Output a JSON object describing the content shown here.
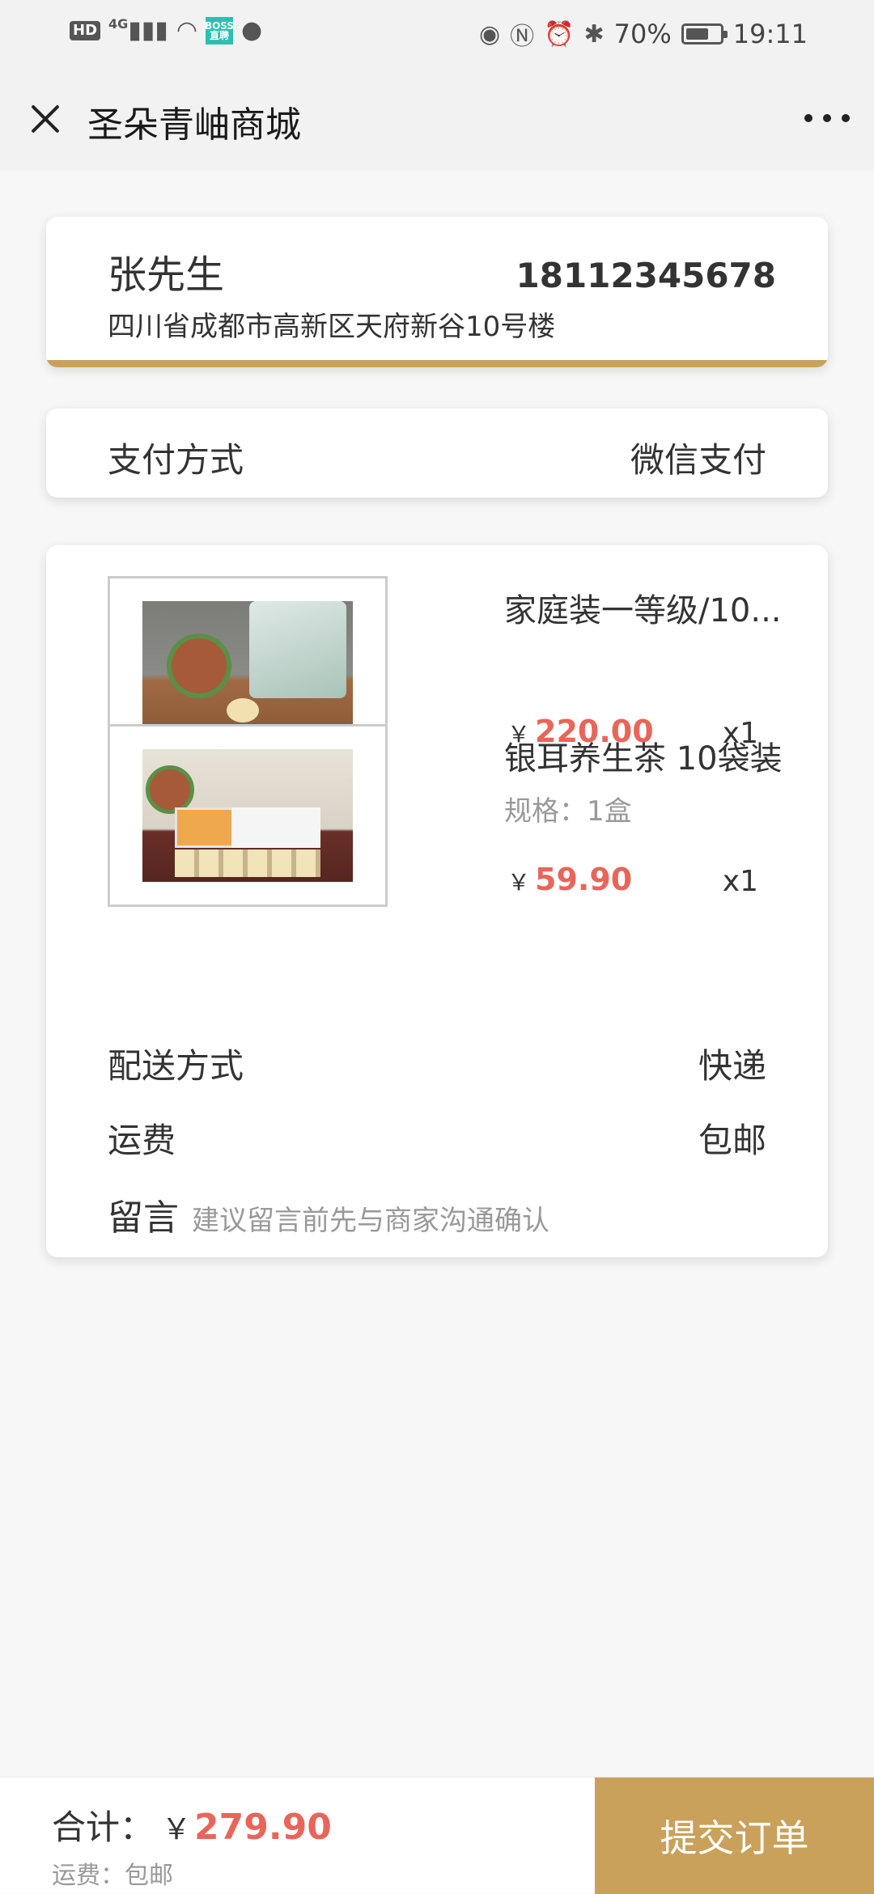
{
  "statusbar": {
    "left_icons": [
      "hd-icon",
      "4g-signal-icon",
      "wifi-icon",
      "boss-app-icon",
      "chat-icon"
    ],
    "hd": "HD",
    "net": "4G",
    "boss": "BOSS直聘",
    "battery": "70%",
    "time": "19:11"
  },
  "navbar": {
    "title": "圣朵青岫商城"
  },
  "address": {
    "name": "张先生",
    "phone": "18112345678",
    "address": "四川省成都市高新区天府新谷10号楼"
  },
  "payment": {
    "label": "支付方式",
    "value": "微信支付"
  },
  "items": [
    {
      "title": "家庭装一等级/10...",
      "spec": "",
      "currency": "￥",
      "price": "220.00",
      "qty": "x1"
    },
    {
      "title": "银耳养生茶 10袋装",
      "spec": "规格：1盒",
      "currency": "￥",
      "price": "59.90",
      "qty": "x1"
    }
  ],
  "delivery": {
    "label": "配送方式",
    "value": "快递"
  },
  "shipping": {
    "label": "运费",
    "value": "包邮"
  },
  "message": {
    "label": "留言",
    "placeholder": "建议留言前先与商家沟通确认"
  },
  "bottom": {
    "total_label": "合计：",
    "currency": "￥",
    "total": "279.90",
    "fee": "运费：包邮",
    "submit": "提交订单"
  },
  "colors": {
    "accent": "#c9a15a",
    "price": "#e8655a"
  }
}
